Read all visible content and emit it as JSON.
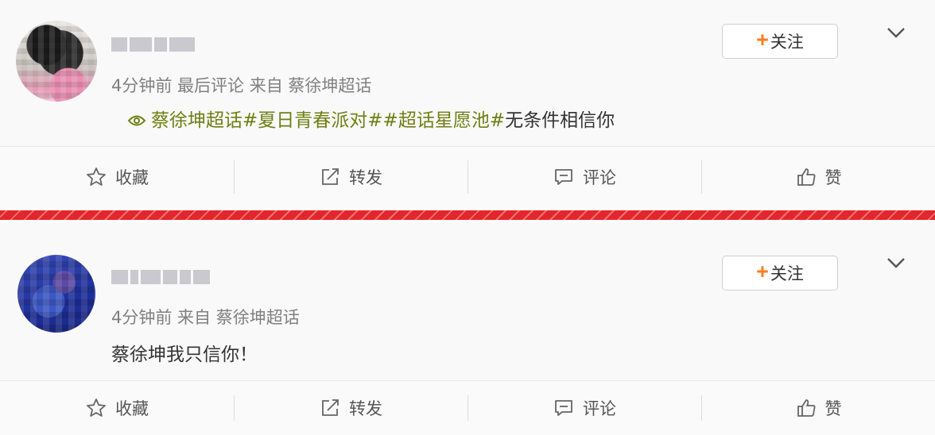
{
  "posts": [
    {
      "meta": "4分钟前  最后评论  来自  蔡徐坤超话",
      "follow_label": "关注",
      "content_links": [
        "蔡徐坤超话",
        "#夏日青春派对#",
        "#超话星愿池#"
      ],
      "content_text": "无条件相信你",
      "actions": [
        "收藏",
        "转发",
        "评论",
        "赞"
      ]
    },
    {
      "meta": "4分钟前  来自  蔡徐坤超话",
      "follow_label": "关注",
      "content_text": "蔡徐坤我只信你！",
      "actions": [
        "收藏",
        "转发",
        "评论",
        "赞"
      ]
    }
  ],
  "colors": {
    "topic_link": "#6f7f12",
    "follow_plus": "#ff7c1f",
    "separator_band": "#e3262b"
  },
  "icons": [
    "supertopic-icon",
    "chevron-down-icon",
    "star-icon",
    "share-icon",
    "comment-icon",
    "thumbs-up-icon"
  ]
}
